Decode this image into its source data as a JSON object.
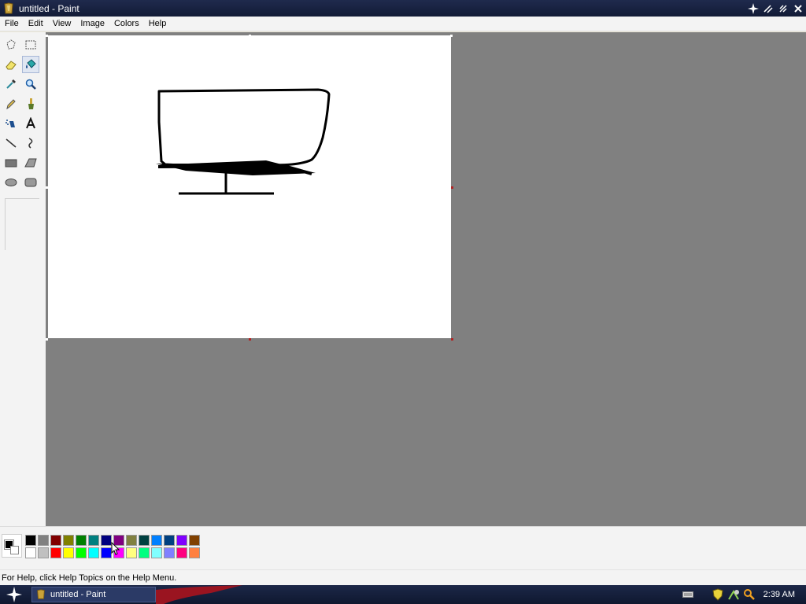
{
  "window": {
    "title": "untitled - Paint"
  },
  "menu": {
    "items": [
      "File",
      "Edit",
      "View",
      "Image",
      "Colors",
      "Help"
    ]
  },
  "tools": [
    {
      "name": "free-form-select-tool",
      "icon": "free-form-select-icon"
    },
    {
      "name": "select-tool",
      "icon": "rectangle-select-icon"
    },
    {
      "name": "eraser-tool",
      "icon": "eraser-icon"
    },
    {
      "name": "fill-tool",
      "icon": "paint-bucket-icon",
      "active": true
    },
    {
      "name": "pick-color-tool",
      "icon": "eyedropper-icon"
    },
    {
      "name": "magnifier-tool",
      "icon": "magnifier-icon"
    },
    {
      "name": "pencil-tool",
      "icon": "pencil-icon"
    },
    {
      "name": "brush-tool",
      "icon": "brush-icon"
    },
    {
      "name": "airbrush-tool",
      "icon": "airbrush-icon"
    },
    {
      "name": "text-tool",
      "icon": "text-icon"
    },
    {
      "name": "line-tool",
      "icon": "line-icon"
    },
    {
      "name": "curve-tool",
      "icon": "curve-icon"
    },
    {
      "name": "rectangle-tool",
      "icon": "rectangle-icon"
    },
    {
      "name": "polygon-tool",
      "icon": "polygon-icon"
    },
    {
      "name": "ellipse-tool",
      "icon": "ellipse-icon"
    },
    {
      "name": "rounded-rectangle-tool",
      "icon": "rounded-rectangle-icon"
    }
  ],
  "colors": {
    "foreground": "#000000",
    "background": "#FFFFFF",
    "palette_top": [
      "#000000",
      "#808080",
      "#800000",
      "#808000",
      "#008000",
      "#008080",
      "#000080",
      "#800080",
      "#808040",
      "#004040",
      "#0080FF",
      "#004080",
      "#8000FF",
      "#804000"
    ],
    "palette_bottom": [
      "#FFFFFF",
      "#C0C0C0",
      "#FF0000",
      "#FFFF00",
      "#00FF00",
      "#00FFFF",
      "#0000FF",
      "#FF00FF",
      "#FFFF80",
      "#00FF80",
      "#80FFFF",
      "#8080FF",
      "#FF0080",
      "#FF8040"
    ]
  },
  "status": {
    "text": "For Help, click Help Topics on the Help Menu."
  },
  "taskbar": {
    "task_label": "untitled - Paint",
    "clock": "2:39 AM",
    "tray_icons": [
      "keyboard-icon",
      "security-shield-icon",
      "network-icon",
      "search-icon"
    ]
  }
}
